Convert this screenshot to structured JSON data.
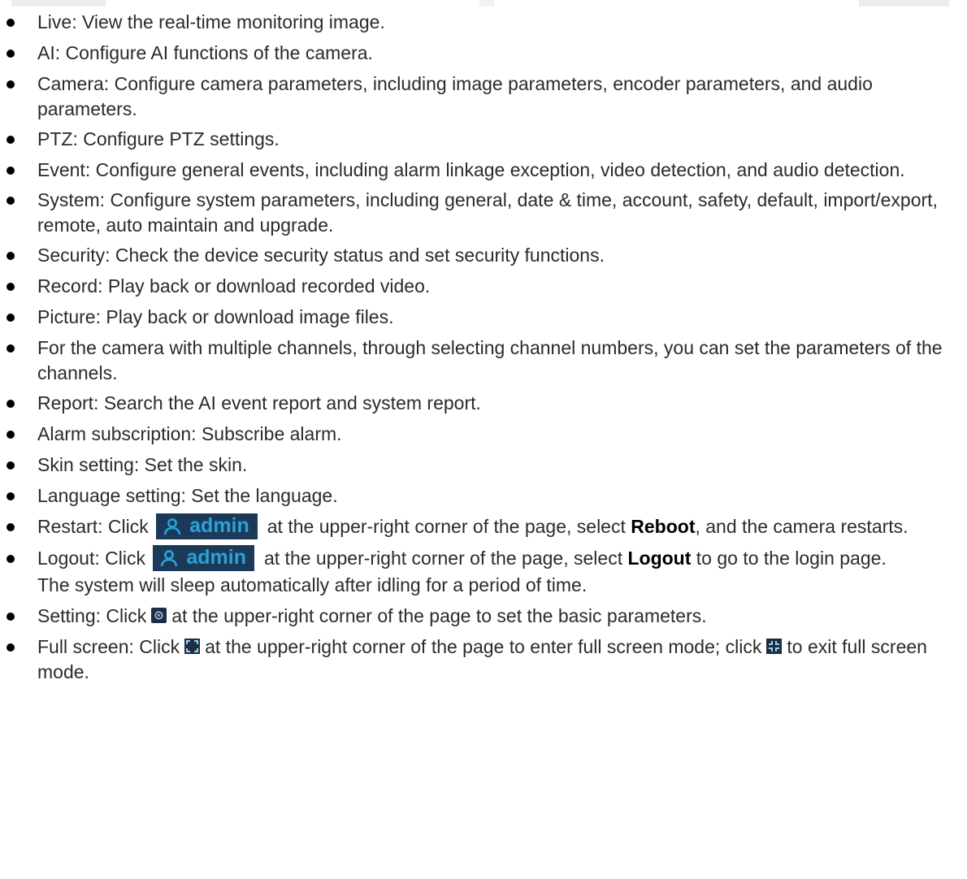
{
  "items": [
    {
      "text": "Live: View the real-time monitoring image."
    },
    {
      "text": "AI: Configure AI functions of the camera."
    },
    {
      "text": "Camera: Configure camera parameters, including image parameters, encoder parameters, and audio parameters."
    },
    {
      "text": "PTZ: Configure PTZ settings."
    },
    {
      "text": "Event: Configure general events, including alarm linkage exception, video detection, and audio detection."
    },
    {
      "text": "System: Configure system parameters, including general, date & time, account, safety, default, import/export, remote, auto maintain and upgrade."
    },
    {
      "text": "Security: Check the device security status and set security functions."
    },
    {
      "text": "Record: Play back or download recorded video."
    },
    {
      "text": "Picture: Play back or download image files."
    },
    {
      "text": "For the camera with multiple channels, through selecting channel numbers, you can set the parameters of the channels."
    },
    {
      "text": "Report: Search the AI event report and system report."
    },
    {
      "text": "Alarm subscription: Subscribe alarm."
    },
    {
      "text": "Skin setting: Set the skin."
    },
    {
      "text": "Language setting: Set the language."
    }
  ],
  "restart": {
    "prefix": "Restart: Click",
    "button_label": "admin",
    "middle": "at the upper-right corner of the page, select",
    "bold": "Reboot",
    "suffix": ", and the camera restarts."
  },
  "logout": {
    "prefix": "Logout: Click",
    "button_label": "admin",
    "middle": "at the upper-right corner of the page, select",
    "bold": "Logout",
    "suffix": "to go to the login page.",
    "note": "The system will sleep automatically after idling for a period of time."
  },
  "setting": {
    "prefix": "Setting: Click",
    "suffix": "at the upper-right corner of the page to set the basic parameters."
  },
  "fullscreen": {
    "prefix": "Full screen: Click",
    "middle": "at the upper-right corner of the page to enter full screen mode; click",
    "suffix": "to exit full screen mode."
  },
  "colors": {
    "button_bg": "#1b3a5a",
    "button_fg": "#29a3d8",
    "icon_bg": "#1f2d44"
  },
  "icons": [
    "user-icon",
    "gear-icon",
    "enter-fullscreen-icon",
    "exit-fullscreen-icon"
  ]
}
